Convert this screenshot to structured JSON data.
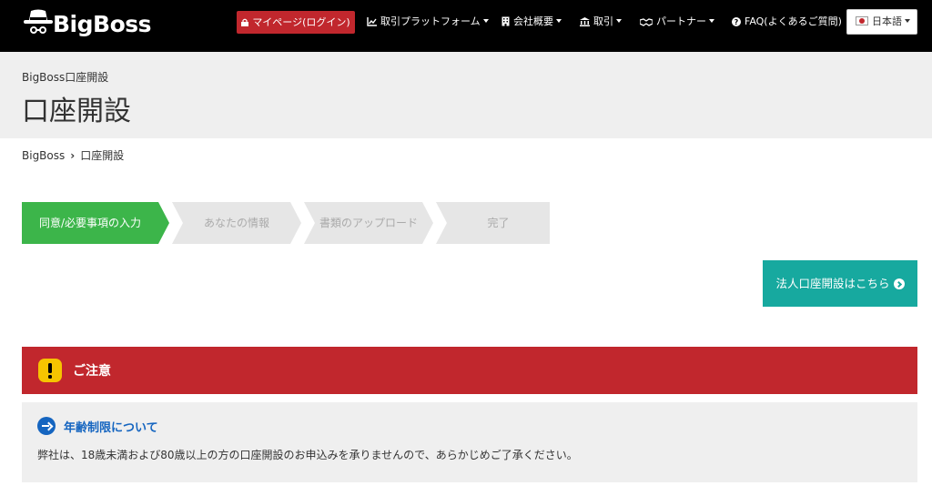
{
  "brand": {
    "logo_text": "BigBoss"
  },
  "nav": {
    "mypage": "マイページ(ログイン)",
    "items": [
      {
        "label": "取引プラットフォーム",
        "icon": "chart-icon",
        "dropdown": true
      },
      {
        "label": "会社概要",
        "icon": "building-icon",
        "dropdown": true
      },
      {
        "label": "取引",
        "icon": "bank-icon",
        "dropdown": true
      },
      {
        "label": "パートナー",
        "icon": "handshake-icon",
        "dropdown": true
      },
      {
        "label": "FAQ(よくあるご質問)",
        "icon": "question-circle-icon",
        "dropdown": false
      }
    ],
    "language": "日本語"
  },
  "header": {
    "subtitle": "BigBoss口座開設",
    "title": "口座開設"
  },
  "breadcrumb": {
    "home": "BigBoss",
    "current": "口座開設"
  },
  "steps": [
    {
      "label": "同意/必要事項の入力",
      "state": "active"
    },
    {
      "label": "あなたの情報",
      "state": "inactive"
    },
    {
      "label": "書類のアップロード",
      "state": "inactive"
    },
    {
      "label": "完了",
      "state": "inactive"
    }
  ],
  "corporate_button": "法人口座開設はこちら",
  "notice": {
    "title": "ご注意",
    "age_title": "年齢制限について",
    "age_text": "弊社は、18歳未満および80歳以上の方の口座開設のお申込みを承りませんので、あらかじめご了承ください。"
  },
  "colors": {
    "topbar": "#000000",
    "mypage": "#c1272d",
    "step_active": "#3cb54a",
    "step_inactive": "#e6e6e6",
    "corporate": "#17a99f",
    "notice": "#c1272d",
    "link_blue": "#1565c0"
  }
}
